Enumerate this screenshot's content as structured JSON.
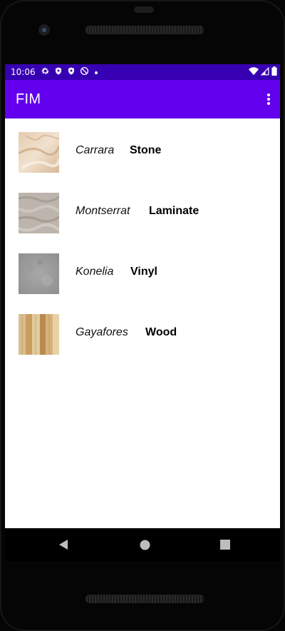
{
  "status_bar": {
    "time": "10:06",
    "icons_left": [
      "settings-icon",
      "shield-icon",
      "shield-icon",
      "no-sim-icon",
      "dot-icon"
    ],
    "icons_right": [
      "wifi-icon",
      "signal-icon",
      "battery-icon"
    ],
    "color": "#3700b3"
  },
  "app_bar": {
    "title": "FIM",
    "color": "#6200ee",
    "overflow_icon": "more-vert-icon"
  },
  "materials": [
    {
      "name": "Carrara",
      "type": "Stone",
      "thumbnail": "marble-texture"
    },
    {
      "name": "Montserrat",
      "type": "Laminate",
      "thumbnail": "grey-granite-texture"
    },
    {
      "name": "Konelia",
      "type": "Vinyl",
      "thumbnail": "grey-concrete-texture"
    },
    {
      "name": "Gayafores",
      "type": "Wood",
      "thumbnail": "wood-plank-texture"
    }
  ],
  "nav_bar": {
    "buttons": [
      "back-icon",
      "home-icon",
      "recents-icon"
    ]
  }
}
